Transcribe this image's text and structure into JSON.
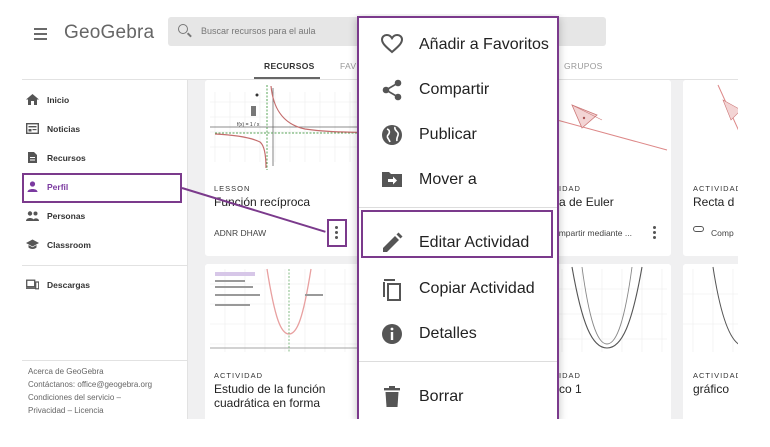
{
  "app": {
    "logo": "GeoGebra"
  },
  "search": {
    "placeholder": "Buscar recursos para el aula"
  },
  "tabs": [
    "RECURSOS",
    "FAV",
    "GRUPOS"
  ],
  "sidebar": {
    "items": [
      {
        "label": "Inicio",
        "icon": "home-icon"
      },
      {
        "label": "Noticias",
        "icon": "news-icon"
      },
      {
        "label": "Recursos",
        "icon": "document-icon"
      },
      {
        "label": "Perfil",
        "icon": "person-icon"
      },
      {
        "label": "Personas",
        "icon": "people-icon"
      },
      {
        "label": "Classroom",
        "icon": "school-icon"
      },
      {
        "label": "Descargas",
        "icon": "devices-icon"
      }
    ],
    "footer": [
      "Acerca de GeoGebra",
      "Contáctanos: office@geogebra.org",
      "Condiciones del servicio  –",
      "Privacidad  –  Licencia"
    ]
  },
  "cards": [
    {
      "type": "LESSON",
      "title": "Función recíproca",
      "author": "ADNR DHAW",
      "formula": "f(x) = 1 / x"
    },
    {
      "type": "IDAD",
      "title": "a de Euler",
      "author": "ompartir mediante ..."
    },
    {
      "type": "ACTIVIDAD",
      "title": "Recta d",
      "author": "Comp"
    },
    {
      "type": "ACTIVIDAD",
      "title": "Estudio de la función cuadrática en forma"
    },
    {
      "type": "IDAD",
      "title": "co 1"
    },
    {
      "type": "ACTIVIDAD",
      "title": "gráfico"
    }
  ],
  "menu": {
    "items": [
      {
        "label": "Añadir a Favoritos",
        "icon": "heart-icon"
      },
      {
        "label": "Compartir",
        "icon": "share-icon"
      },
      {
        "label": "Publicar",
        "icon": "globe-icon"
      },
      {
        "label": "Mover a",
        "icon": "folder-move-icon"
      },
      {
        "label": "Editar Actividad",
        "icon": "pencil-icon"
      },
      {
        "label": "Copiar Actividad",
        "icon": "copy-icon"
      },
      {
        "label": "Detalles",
        "icon": "info-icon"
      },
      {
        "label": "Borrar",
        "icon": "trash-icon"
      }
    ]
  },
  "colors": {
    "highlight": "#7b3a8c",
    "accent": "#7b3aa0"
  }
}
